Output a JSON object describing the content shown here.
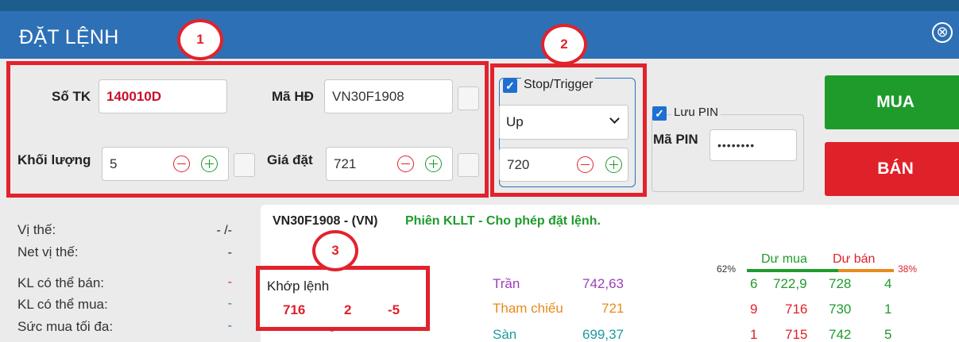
{
  "window": {
    "title": "ĐẶT LỆNH",
    "close_icon": "⊗"
  },
  "badges": [
    "1",
    "2",
    "3"
  ],
  "form": {
    "account_label": "Số TK",
    "account_value": "140010D",
    "contract_label": "Mã HĐ",
    "contract_value": "VN30F1908",
    "quantity_label": "Khối lượng",
    "quantity_value": "5",
    "price_label": "Giá đặt",
    "price_value": "721"
  },
  "stop": {
    "checked_icon": "✓",
    "label": "Stop/Trigger",
    "direction": "Up",
    "trigger_price": "720"
  },
  "pin": {
    "checked_icon": "✓",
    "save_label": "Lưu PIN",
    "pin_label": "Mã PIN",
    "pin_value": "••••••••"
  },
  "buttons": {
    "buy": "MUA",
    "sell": "BÁN"
  },
  "position": {
    "items": [
      {
        "label": "Vị thế:",
        "value": "- /-",
        "color": "#333333"
      },
      {
        "label": "Net vị thế:",
        "value": "-",
        "color": "#333333"
      },
      {
        "label": "KL có thể bán:",
        "value": "-",
        "color": "#df2129"
      },
      {
        "label": "KL có thể mua:",
        "value": "-",
        "color": "#1f9b2c"
      },
      {
        "label": "Sức mua tối đa:",
        "value": "-",
        "color": "#1f6fd2"
      }
    ],
    "extra_dash": "-"
  },
  "market": {
    "header_symbol": "VN30F1908 - (VN)",
    "session_text": "Phiên KLLT - Cho phép đặt lệnh.",
    "matched_label": "Khớp lệnh",
    "matched_price": "716",
    "matched_volume": "2",
    "matched_change": "-5",
    "ceiling_label": "Trần",
    "ceiling_value": "742,63",
    "reference_label": "Tham chiếu",
    "reference_value": "721",
    "floor_label": "Sàn",
    "floor_value": "699,37",
    "buy_pct": "62%",
    "sell_pct": "38%",
    "buy_fraction": 0.62,
    "buy_side_label": "Dư mua",
    "sell_side_label": "Dư bán",
    "depth": [
      {
        "bid_vol": "6",
        "bid_price": "722,9",
        "ask_price": "728",
        "ask_vol": "4",
        "color": "#1f9b2c"
      },
      {
        "bid_vol": "9",
        "bid_price": "716",
        "ask_price": "730",
        "ask_vol": "1",
        "color": "#df2129"
      },
      {
        "bid_vol": "1",
        "bid_price": "715",
        "ask_price": "742",
        "ask_vol": "5",
        "color": "#df2129"
      }
    ]
  }
}
